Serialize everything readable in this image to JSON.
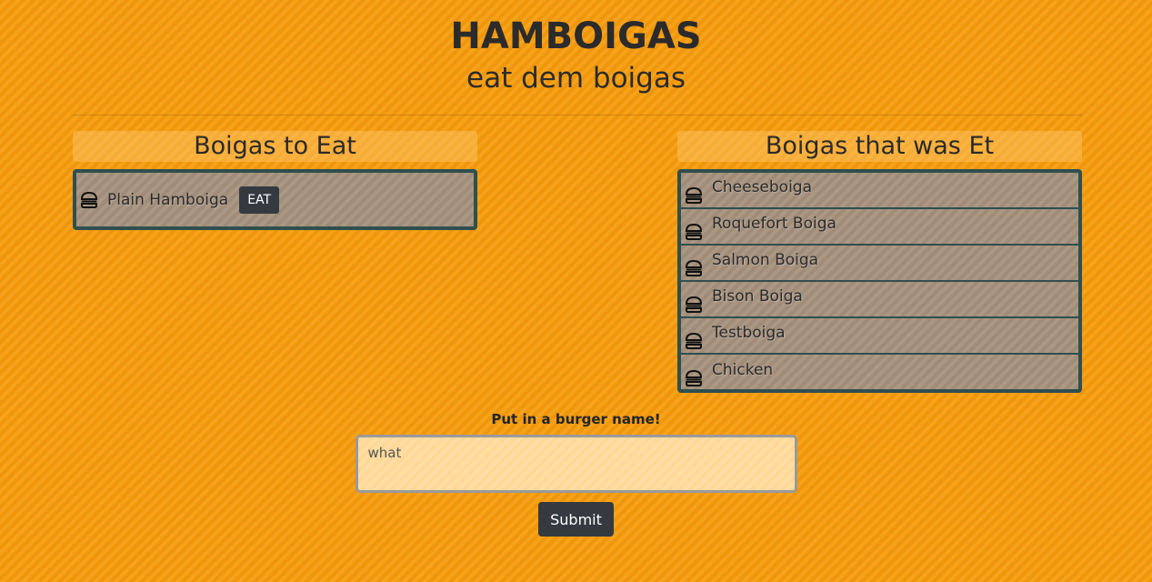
{
  "header": {
    "title": "HAMBOIGAS",
    "subtitle": "eat dem boigas"
  },
  "to_eat": {
    "heading": "Boigas to Eat",
    "items": [
      {
        "name": "Plain Hamboiga",
        "button_label": "EAT",
        "icon": "hamburger-icon"
      }
    ]
  },
  "eaten": {
    "heading": "Boigas that was Et",
    "items": [
      {
        "name": "Cheeseboiga",
        "icon": "hamburger-icon"
      },
      {
        "name": "Roquefort Boiga",
        "icon": "hamburger-icon"
      },
      {
        "name": "Salmon Boiga",
        "icon": "hamburger-icon"
      },
      {
        "name": "Bison Boiga",
        "icon": "hamburger-icon"
      },
      {
        "name": "Testboiga",
        "icon": "hamburger-icon"
      },
      {
        "name": "Chicken",
        "icon": "hamburger-icon"
      }
    ]
  },
  "form": {
    "label": "Put in a burger name!",
    "input_value": "what",
    "submit_label": "Submit"
  },
  "colors": {
    "background": "#f39c12",
    "list_border": "#2f4f4f",
    "button": "#343a40"
  }
}
